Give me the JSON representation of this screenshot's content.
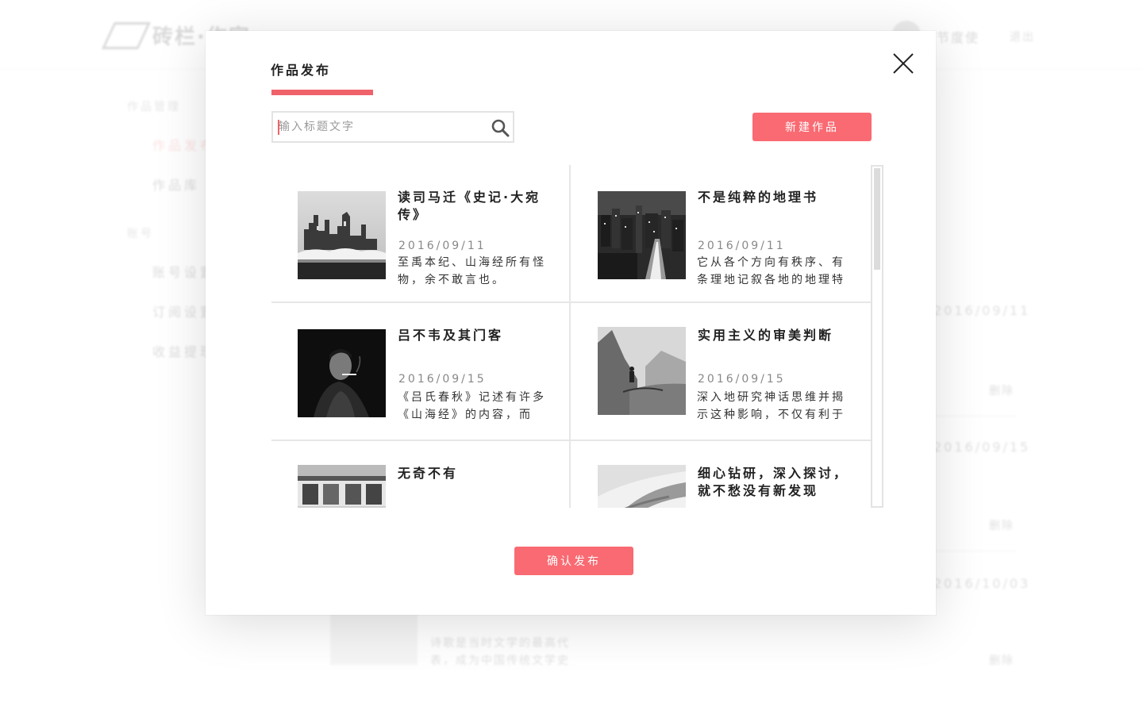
{
  "background": {
    "logo_text": "砖栏·作家",
    "username": "节度使",
    "logout": "退出",
    "sidebar": [
      {
        "type": "section",
        "label": "作品管理"
      },
      {
        "type": "item",
        "label": "作品发布",
        "active": true
      },
      {
        "type": "item",
        "label": "作品库"
      },
      {
        "type": "section",
        "label": "账号"
      },
      {
        "type": "item",
        "label": "账号设置"
      },
      {
        "type": "item",
        "label": "订阅设置"
      },
      {
        "type": "item",
        "label": "收益提现"
      }
    ],
    "list_dates": [
      "2016/09/11",
      "2016/09/15",
      "2016/10/03"
    ],
    "delete_label": "删除",
    "snippet_lines": [
      "诗歌是当时文学的最高代",
      "表，成为中国传统文学史"
    ]
  },
  "modal": {
    "title": "作品发布",
    "search": {
      "placeholder": "输入标题文字",
      "value": ""
    },
    "new_button": "新建作品",
    "confirm_button": "确认发布",
    "works": [
      {
        "title": "读司马迁《史记·大宛传》",
        "date": "2016/09/11",
        "desc": "至禹本纪、山海经所有怪物，余不敢言也。",
        "thumb": "castle-ruins-photo"
      },
      {
        "title": "不是纯粹的地理书",
        "date": "2016/09/11",
        "desc": "它从各个方向有秩序、有条理地记叙各地的地理特",
        "thumb": "night-city-photo"
      },
      {
        "title": "吕不韦及其门客",
        "date": "2016/09/15",
        "desc": "《吕氏春秋》记述有许多《山海经》的内容，而",
        "thumb": "smoking-man-photo"
      },
      {
        "title": "实用主义的审美判断",
        "date": "2016/09/15",
        "desc": "深入地研究神话思维并揭示这种影响，不仅有利于",
        "thumb": "mountain-cliff-photo"
      },
      {
        "title": "无奇不有",
        "date": "",
        "desc": "",
        "thumb": "street-building-photo"
      },
      {
        "title": "细心钻研，深入探讨，就不愁没有新发现",
        "date": "",
        "desc": "",
        "thumb": "hand-closeup-photo"
      }
    ]
  },
  "colors": {
    "accent": "#f96a72",
    "accent_line": "#f0626a",
    "border": "#e6e6e6"
  }
}
